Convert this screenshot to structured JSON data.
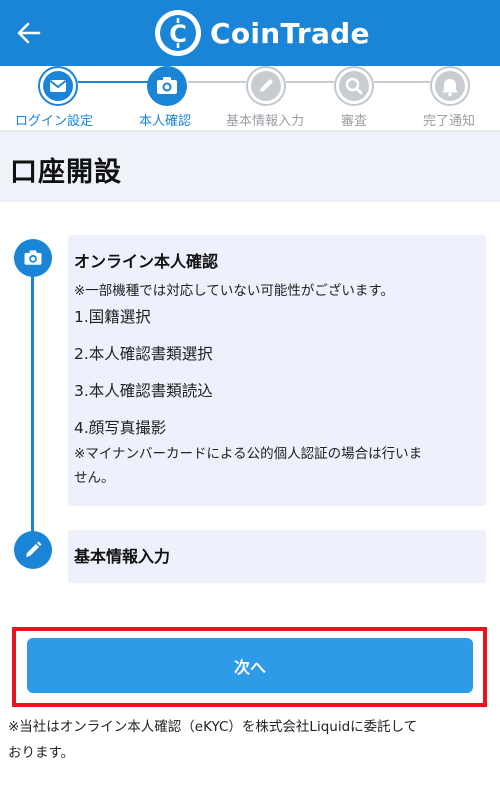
{
  "header": {
    "brand_name": "CoinTrade",
    "logo_glyph": "C",
    "back_icon": "arrow-left-icon",
    "color": "#1a85d6"
  },
  "stepper": {
    "steps": [
      {
        "label": "ログイン設定",
        "icon": "mail-icon",
        "state": "done"
      },
      {
        "label": "本人確認",
        "icon": "camera-icon",
        "state": "current"
      },
      {
        "label": "基本情報入力",
        "icon": "pencil-icon",
        "state": "pending"
      },
      {
        "label": "審査",
        "icon": "search-icon",
        "state": "pending"
      },
      {
        "label": "完了通知",
        "icon": "bell-icon",
        "state": "pending"
      }
    ],
    "active_color": "#1a85d6",
    "inactive_color": "#b9bec4"
  },
  "page": {
    "title": "口座開設"
  },
  "timeline": {
    "online_kyc": {
      "icon": "camera-icon",
      "title": "オンライン本人確認",
      "note_top": "※一部機種では対応していない可能性がございます。",
      "items": [
        "1.国籍選択",
        "2.本人確認書類選択",
        "3.本人確認書類読込",
        "4.顔写真撮影"
      ],
      "note_bottom_line1": "※マイナンバーカードによる公的個人認証の場合は行いま",
      "note_bottom_line2": "せん。"
    },
    "basic_info": {
      "icon": "pencil-icon",
      "title": "基本情報入力"
    }
  },
  "actions": {
    "next_label": "次へ",
    "button_color": "#2d9be7",
    "highlight_color": "#e5161b"
  },
  "footnote": {
    "line1": "※当社はオンライン本人確認（eKYC）を株式会社Liquidに委託して",
    "line2": "おります。"
  }
}
